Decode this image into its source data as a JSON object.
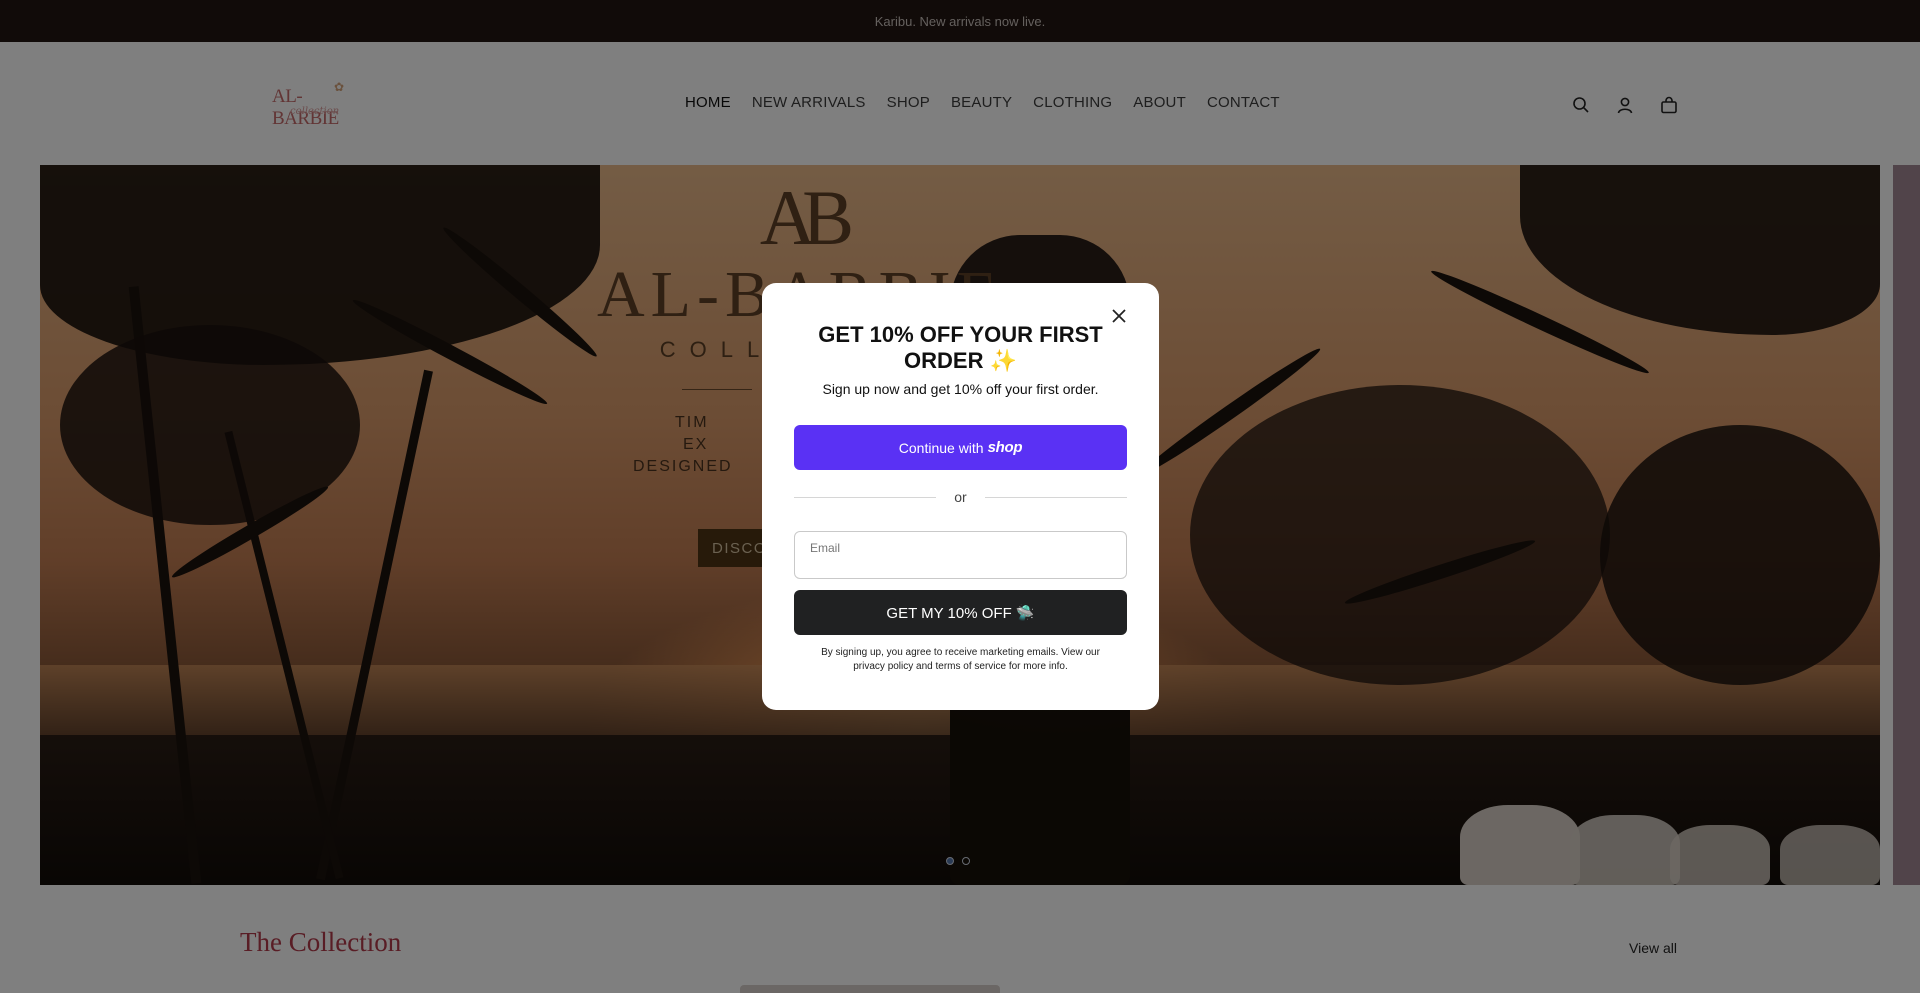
{
  "announcement": {
    "text": "Karibu. New arrivals now live."
  },
  "header": {
    "logo": {
      "text": "AL-BARBIE",
      "script": "collection"
    },
    "nav": [
      {
        "label": "HOME"
      },
      {
        "label": "NEW ARRIVALS"
      },
      {
        "label": "SHOP"
      },
      {
        "label": "BEAUTY"
      },
      {
        "label": "CLOTHING"
      },
      {
        "label": "ABOUT"
      },
      {
        "label": "CONTACT"
      }
    ],
    "icons": [
      "search-icon",
      "account-icon",
      "cart-icon"
    ]
  },
  "hero": {
    "monogram": "AB",
    "brand_title": "AL-BARBIE",
    "brand_sub": "COLLECTION",
    "tagline_lines": [
      "TIM",
      "EX",
      "DESIGNED"
    ],
    "button_label": "DISCO",
    "slides": {
      "count": 2,
      "active": 1
    }
  },
  "collection": {
    "title": "The Collection",
    "view_all": "View all"
  },
  "modal": {
    "title": "GET 10% OFF YOUR FIRST ORDER ✨",
    "subtitle": "Sign up now and get 10% off your first order.",
    "shop_button": {
      "prefix": "Continue with",
      "brand": "shop"
    },
    "divider": "or",
    "email": {
      "label": "Email",
      "value": ""
    },
    "cta_label": "GET MY 10% OFF 🛸",
    "legal": "By signing up, you agree to receive marketing emails. View our privacy policy and terms of service for more info."
  },
  "colors": {
    "announcement_bg": "#231613",
    "shop_purple": "#5a31f4",
    "cta_bg": "#202122",
    "collection_title": "#b23a4a"
  }
}
